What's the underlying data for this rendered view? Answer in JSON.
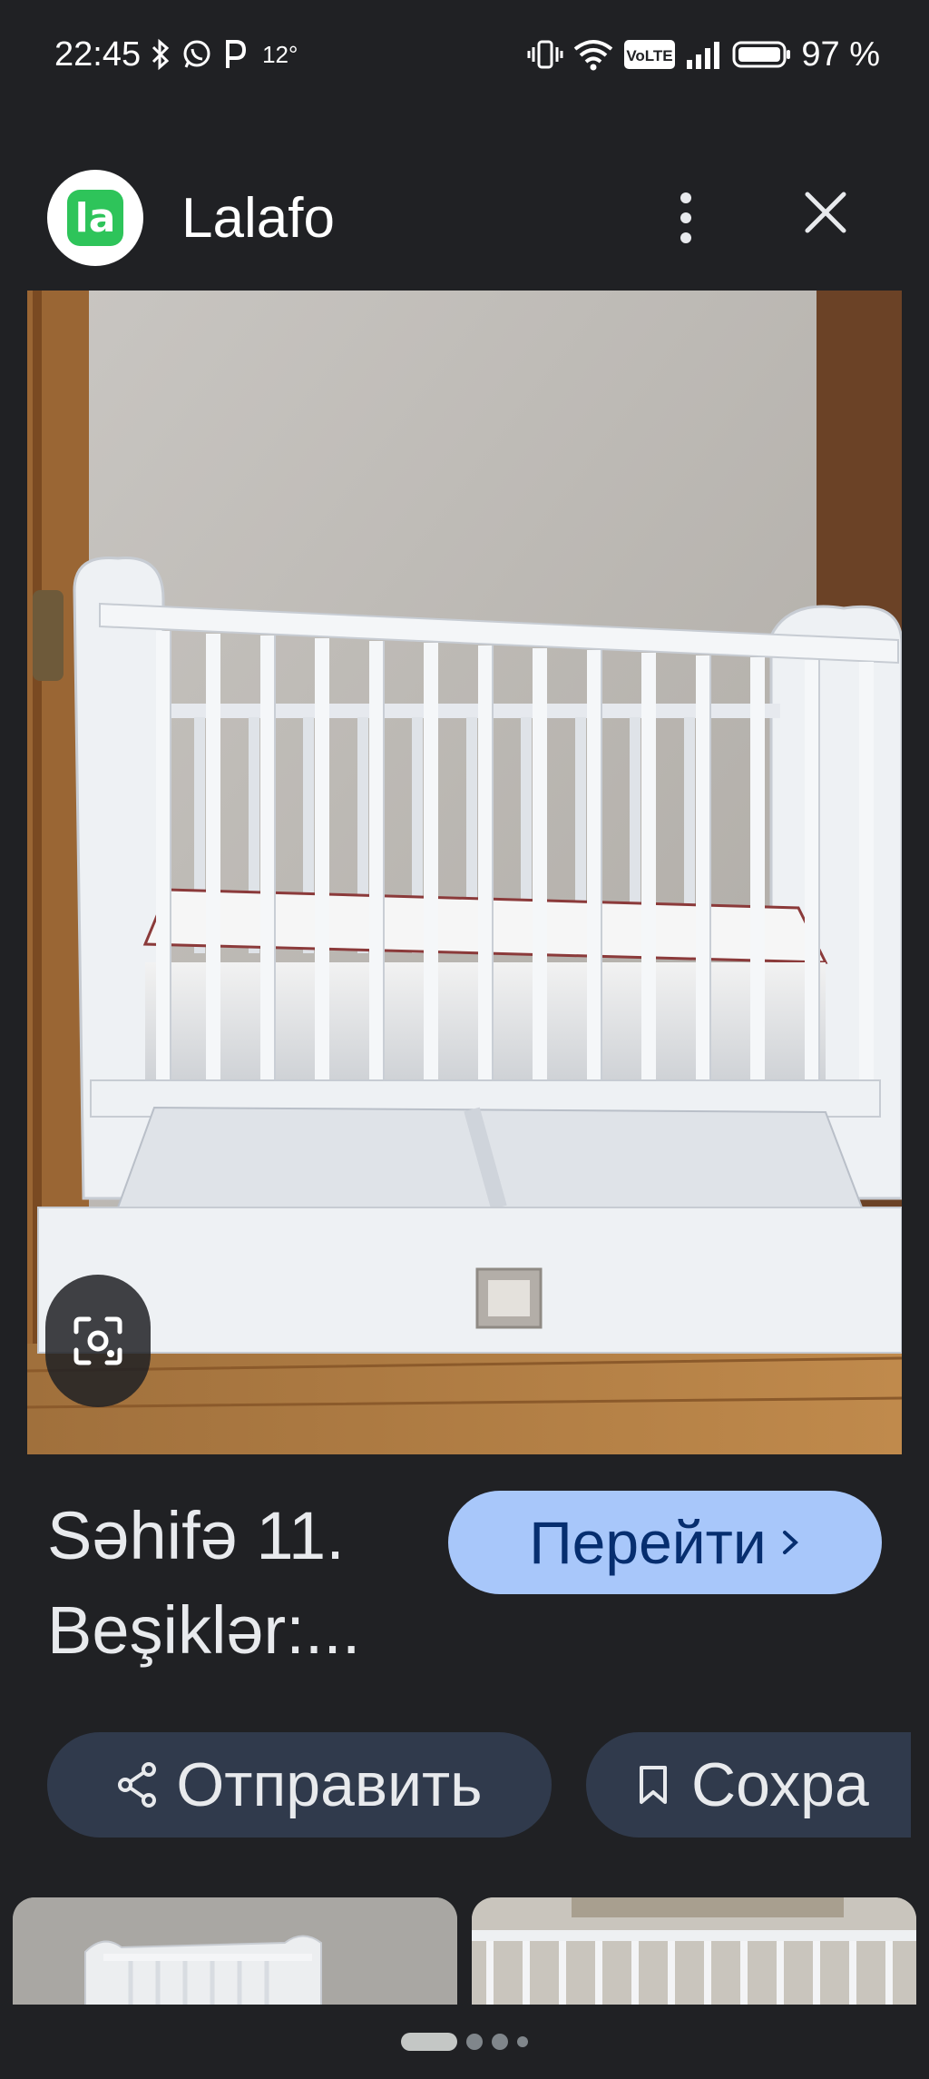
{
  "status_bar": {
    "time": "22:45",
    "temperature": "12°",
    "battery_percent": "97 %",
    "network_label": "VoLTE"
  },
  "header": {
    "site_name": "Lalafo",
    "logo_text": "la"
  },
  "result": {
    "title_line1": "Səhifə 11.",
    "title_line2": "Beşiklər:...",
    "visit_button_label": "Перейти",
    "share_label": "Отправить",
    "save_label": "Сохра"
  },
  "colors": {
    "background": "#202124",
    "visit_button_bg": "#a8c7fa",
    "chip_bg": "#303a4c",
    "logo_green": "#2ec45a"
  },
  "icons": [
    "bluetooth-icon",
    "whatsapp-icon",
    "parking-icon",
    "vibrate-icon",
    "wifi-icon",
    "signal-icon",
    "battery-icon",
    "more-vert-icon",
    "close-icon",
    "lens-icon",
    "share-icon",
    "bookmark-icon",
    "chevron-right-icon"
  ],
  "pager": {
    "current": 1,
    "total": 4
  }
}
